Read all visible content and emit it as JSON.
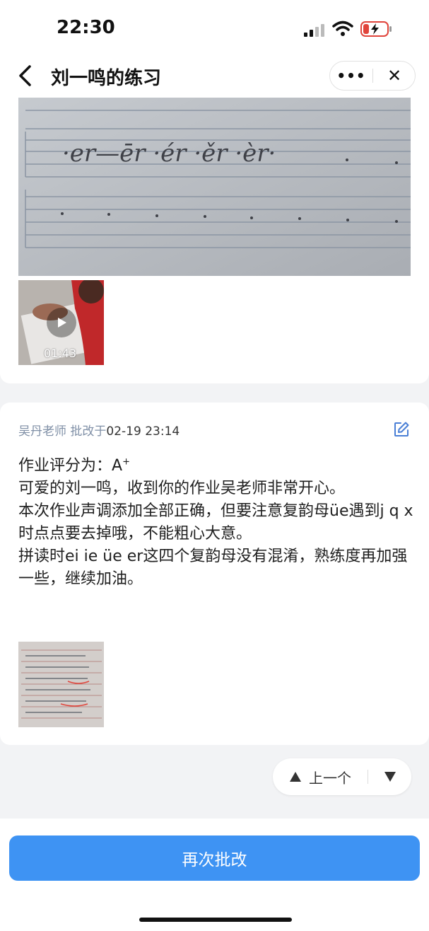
{
  "status_bar": {
    "time": "22:30"
  },
  "nav": {
    "title": "刘一鸣的练习"
  },
  "video": {
    "duration": "01:43"
  },
  "review": {
    "teacher": "吴丹老师",
    "graded_prefix": "批改于",
    "graded_date": "02-19 23:14",
    "score_label": "作业评分为：A",
    "score_sup": "+",
    "comment_lines": [
      "可爱的刘一鸣，收到你的作业吴老师非常开心。",
      "本次作业声调添加全部正确，但要注意复韵母üe遇到j q x时点点要去掉哦，不能粗心大意。",
      "拼读时ei ie üe er这四个复韵母没有混淆，熟练度再加强一些，继续加油。"
    ]
  },
  "photo": {
    "handwriting": "·er—ēr ·ér ·ěr ·èr·"
  },
  "pager": {
    "prev_label": "上一个"
  },
  "actions": {
    "regrade_label": "再次批改"
  },
  "colors": {
    "accent": "#3e93f3",
    "teacher_name": "#7f8fa6",
    "background": "#f2f3f5"
  }
}
